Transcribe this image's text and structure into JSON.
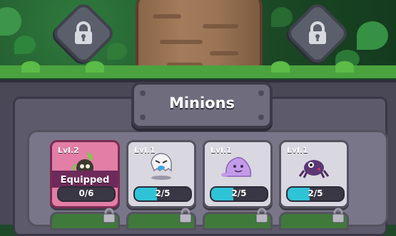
{
  "scene": {
    "locks": [
      {
        "name": "left-lock-icon"
      },
      {
        "name": "right-lock-icon"
      }
    ]
  },
  "panel": {
    "title": "Minions"
  },
  "minions": [
    {
      "level": "Lvl.2",
      "equipped": true,
      "equipped_label": "Equipped",
      "progress_text": "0/6",
      "progress": 0.0,
      "icon": "plant-minion-icon"
    },
    {
      "level": "Lvl.1",
      "equipped": false,
      "progress_text": "2/5",
      "progress": 0.4,
      "icon": "ghost-minion-icon"
    },
    {
      "level": "Lvl.1",
      "equipped": false,
      "progress_text": "2/5",
      "progress": 0.4,
      "icon": "slime-minion-icon"
    },
    {
      "level": "Lvl.1",
      "equipped": false,
      "progress_text": "2/5",
      "progress": 0.4,
      "icon": "spider-minion-icon"
    }
  ],
  "colors": {
    "progress_fill": "#2fc3d8",
    "equipped_card": "#e37ea6",
    "card": "#d9d7df"
  }
}
